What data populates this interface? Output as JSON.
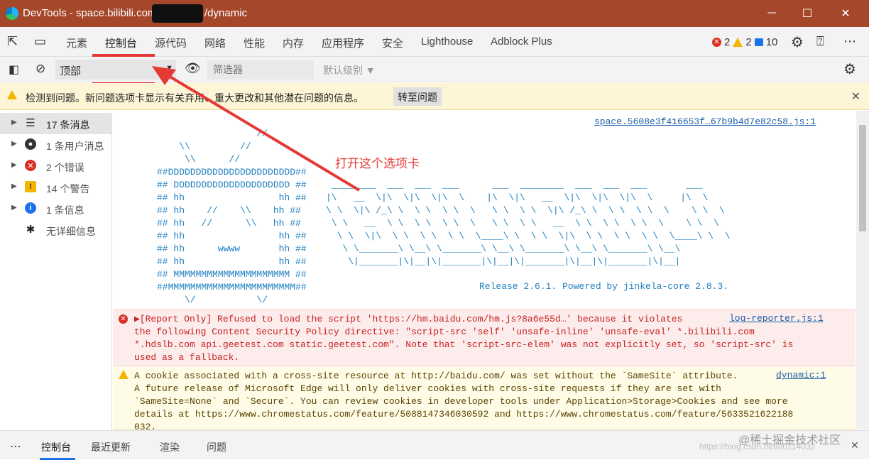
{
  "window": {
    "title": "DevTools - space.bilibili.com/",
    "title_suffix": "/dynamic",
    "min": "─",
    "max": "☐",
    "close": "✕"
  },
  "tabs": [
    {
      "label": "元素"
    },
    {
      "label": "控制台"
    },
    {
      "label": "源代码"
    },
    {
      "label": "网络"
    },
    {
      "label": "性能"
    },
    {
      "label": "内存"
    },
    {
      "label": "应用程序"
    },
    {
      "label": "安全"
    },
    {
      "label": "Lighthouse"
    },
    {
      "label": "Adblock Plus"
    }
  ],
  "issue_counts": {
    "errors": "2",
    "warnings": "2",
    "messages": "10"
  },
  "console_toolbar": {
    "context": "顶部",
    "filter_placeholder": "筛选器",
    "level": "默认级别 ▼"
  },
  "banner": {
    "text": "检测到问题。新问题选项卡显示有关弃用、重大更改和其他潜在问题的信息。",
    "button": "转至问题",
    "close": "✕"
  },
  "sidebar": [
    {
      "label": "17 条消息",
      "icon": "list-icon"
    },
    {
      "label": "1 条用户消息",
      "icon": "user-icon"
    },
    {
      "label": "2 个错误",
      "icon": "error-icon"
    },
    {
      "label": "14 个警告",
      "icon": "warning-icon"
    },
    {
      "label": "1 条信息",
      "icon": "info-icon"
    },
    {
      "label": "无详细信息",
      "icon": "bug-icon"
    }
  ],
  "console": {
    "first_source": "space.5608e3f416653f…67b9b4d7e82c58.js:1",
    "ascii_left": "                  //\n    \\\\         //\n     \\\\      //\n##DDDDDDDDDDDDDDDDDDDDDDD##\n## DDDDDDDDDDDDDDDDDDDDD ##\n## hh                 hh ##\n## hh    //    \\\\    hh ##\n## hh   //      \\\\   hh ##\n## hh                 hh ##\n## hh      wwww       hh ##\n## hh                 hh ##\n## MMMMMMMMMMMMMMMMMMMMM ##\n##MMMMMMMMMMMMMMMMMMMMMMM##\n     \\/           \\/",
    "ascii_right": " ________  ___  ___  ___      ___  ________  ___  ___  ___       ___\n|\\   __  \\|\\  \\|\\  \\|\\  \\    |\\  \\|\\   __  \\|\\  \\|\\  \\|\\  \\     |\\  \\\n\\ \\  \\|\\ /_\\ \\  \\ \\  \\ \\  \\   \\ \\  \\ \\  \\|\\ /_\\ \\  \\ \\  \\ \\  \\    \\ \\  \\\n \\ \\   __  \\ \\  \\ \\  \\ \\  \\   \\ \\  \\ \\   __  \\ \\  \\ \\  \\ \\  \\    \\ \\  \\\n  \\ \\  \\|\\  \\ \\  \\ \\  \\ \\  \\____\\ \\  \\ \\  \\|\\  \\ \\  \\ \\  \\ \\  \\____\\ \\  \\\n   \\ \\_______\\ \\__\\ \\_______\\ \\__\\ \\_______\\ \\__\\ \\_______\\ \\__\\\n    \\|_______|\\|__|\\|_______|\\|__|\\|_______|\\|__|\\|_______|\\|__|",
    "release": "Release 2.6.1. Powered by jinkela-core 2.8.3.",
    "error_message": "▶[Report Only] Refused to load the script 'https://hm.baidu.com/hm.js?8a6e55d…' because it violates\nthe following Content Security Policy directive: \"script-src 'self' 'unsafe-inline' 'unsafe-eval' *.bilibili.com\n*.hdslb.com api.geetest.com static.geetest.com\". Note that 'script-src-elem' was not explicitly set, so 'script-src' is\nused as a fallback.",
    "error_source": "log-reporter.js:1",
    "warning_message": "A cookie associated with a cross-site resource at http://baidu.com/ was set without the `SameSite` attribute.\nA future release of Microsoft Edge will only deliver cookies with cross-site requests if they are set with\n`SameSite=None` and `Secure`. You can review cookies in developer tools under Application>Storage>Cookies and see more\ndetails at https://www.chromestatus.com/feature/5088147346030592 and https://www.chromestatus.com/feature/5633521622188\n032.",
    "warning_source": "dynamic:1"
  },
  "drawer": {
    "more": "⋮",
    "tabs": [
      {
        "label": "控制台"
      },
      {
        "label": "最近更新"
      },
      {
        "label": "渲染"
      },
      {
        "label": "问题"
      }
    ],
    "close": "✕"
  },
  "annotation": {
    "text": "打开这个选项卡"
  },
  "watermark": {
    "text": "@稀土掘金技术社区",
    "url": "https://blog.csdn.net/u0114032"
  },
  "colors": {
    "accent": "#1a73e8",
    "titlebar": "#a5472a",
    "annotation": "#e53935"
  }
}
